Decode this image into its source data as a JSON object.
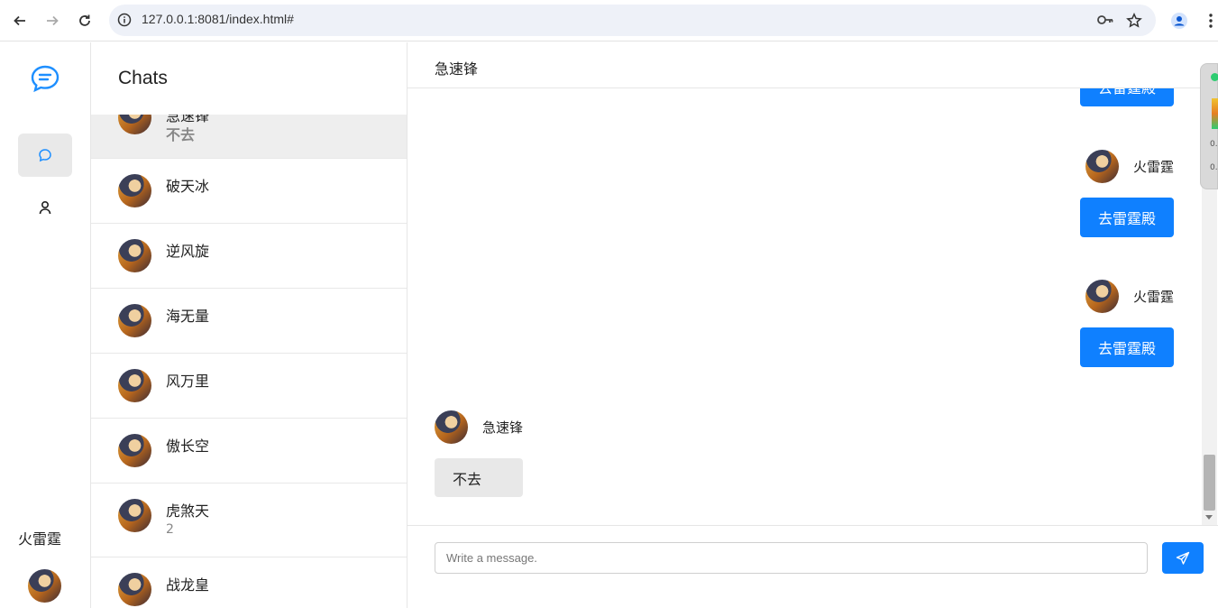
{
  "browser": {
    "url": "127.0.0.1:8081/index.html#"
  },
  "rail": {
    "current_user": "火雷霆"
  },
  "chat_list": {
    "title": "Chats",
    "items": [
      {
        "name": "急速锋",
        "sub": "不去"
      },
      {
        "name": "破天冰",
        "sub": ""
      },
      {
        "name": "逆风旋",
        "sub": ""
      },
      {
        "name": "海无量",
        "sub": ""
      },
      {
        "name": "风万里",
        "sub": ""
      },
      {
        "name": "傲长空",
        "sub": ""
      },
      {
        "name": "虎煞天",
        "sub": "2"
      },
      {
        "name": "战龙皇",
        "sub": ""
      }
    ]
  },
  "conversation": {
    "title": "急速锋",
    "messages": [
      {
        "direction": "out",
        "sender": "火雷霆",
        "text": "去雷霆殿"
      },
      {
        "direction": "out",
        "sender": "火雷霆",
        "text": "去雷霆殿"
      },
      {
        "direction": "out",
        "sender": "火雷霆",
        "text": "去雷霆殿"
      },
      {
        "direction": "in",
        "sender": "急速锋",
        "text": "不去"
      }
    ],
    "input_placeholder": "Write a message."
  },
  "widget": {
    "line1": "0.",
    "line2": "0."
  },
  "colors": {
    "accent": "#0f80ff",
    "incoming_bubble": "#e8e8e8",
    "selected_row": "#eeeeee"
  }
}
